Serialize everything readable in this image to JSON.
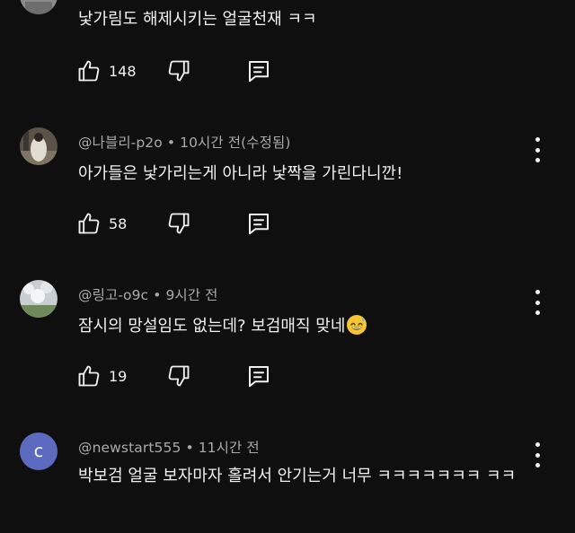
{
  "comments": [
    {
      "author": "",
      "time": "",
      "text": "낯가림도 해제시키는 얼굴천재 ㅋㅋ",
      "likes": "148",
      "avatar_icon": "user-photo-avatar"
    },
    {
      "author": "@나블리-p2o",
      "time": "10시간 전(수정됨)",
      "text": "아가들은 낯가리는게 아니라 낯짝을 가린다니깐!",
      "likes": "58",
      "avatar_icon": "user-photo-avatar"
    },
    {
      "author": "@링고-o9c",
      "time": "9시간 전",
      "text": "잠시의 망설임도 없는데? 보검매직 맞네",
      "emoji": "sweat-smile-emoji",
      "likes": "19",
      "avatar_icon": "user-photo-avatar"
    },
    {
      "author": "@newstart555",
      "time": "11시간 전",
      "text": "박보검 얼굴 보자마자 홀려서 안기는거 너무 ㅋㅋㅋㅋㅋㅋㅋ ㅋㅋ",
      "avatar_letter": "c",
      "avatar_color": "#5c6bc0"
    }
  ],
  "colors": {
    "background": "#0f0f0f",
    "text": "#f1f1f1",
    "meta": "#aaaaaa"
  }
}
